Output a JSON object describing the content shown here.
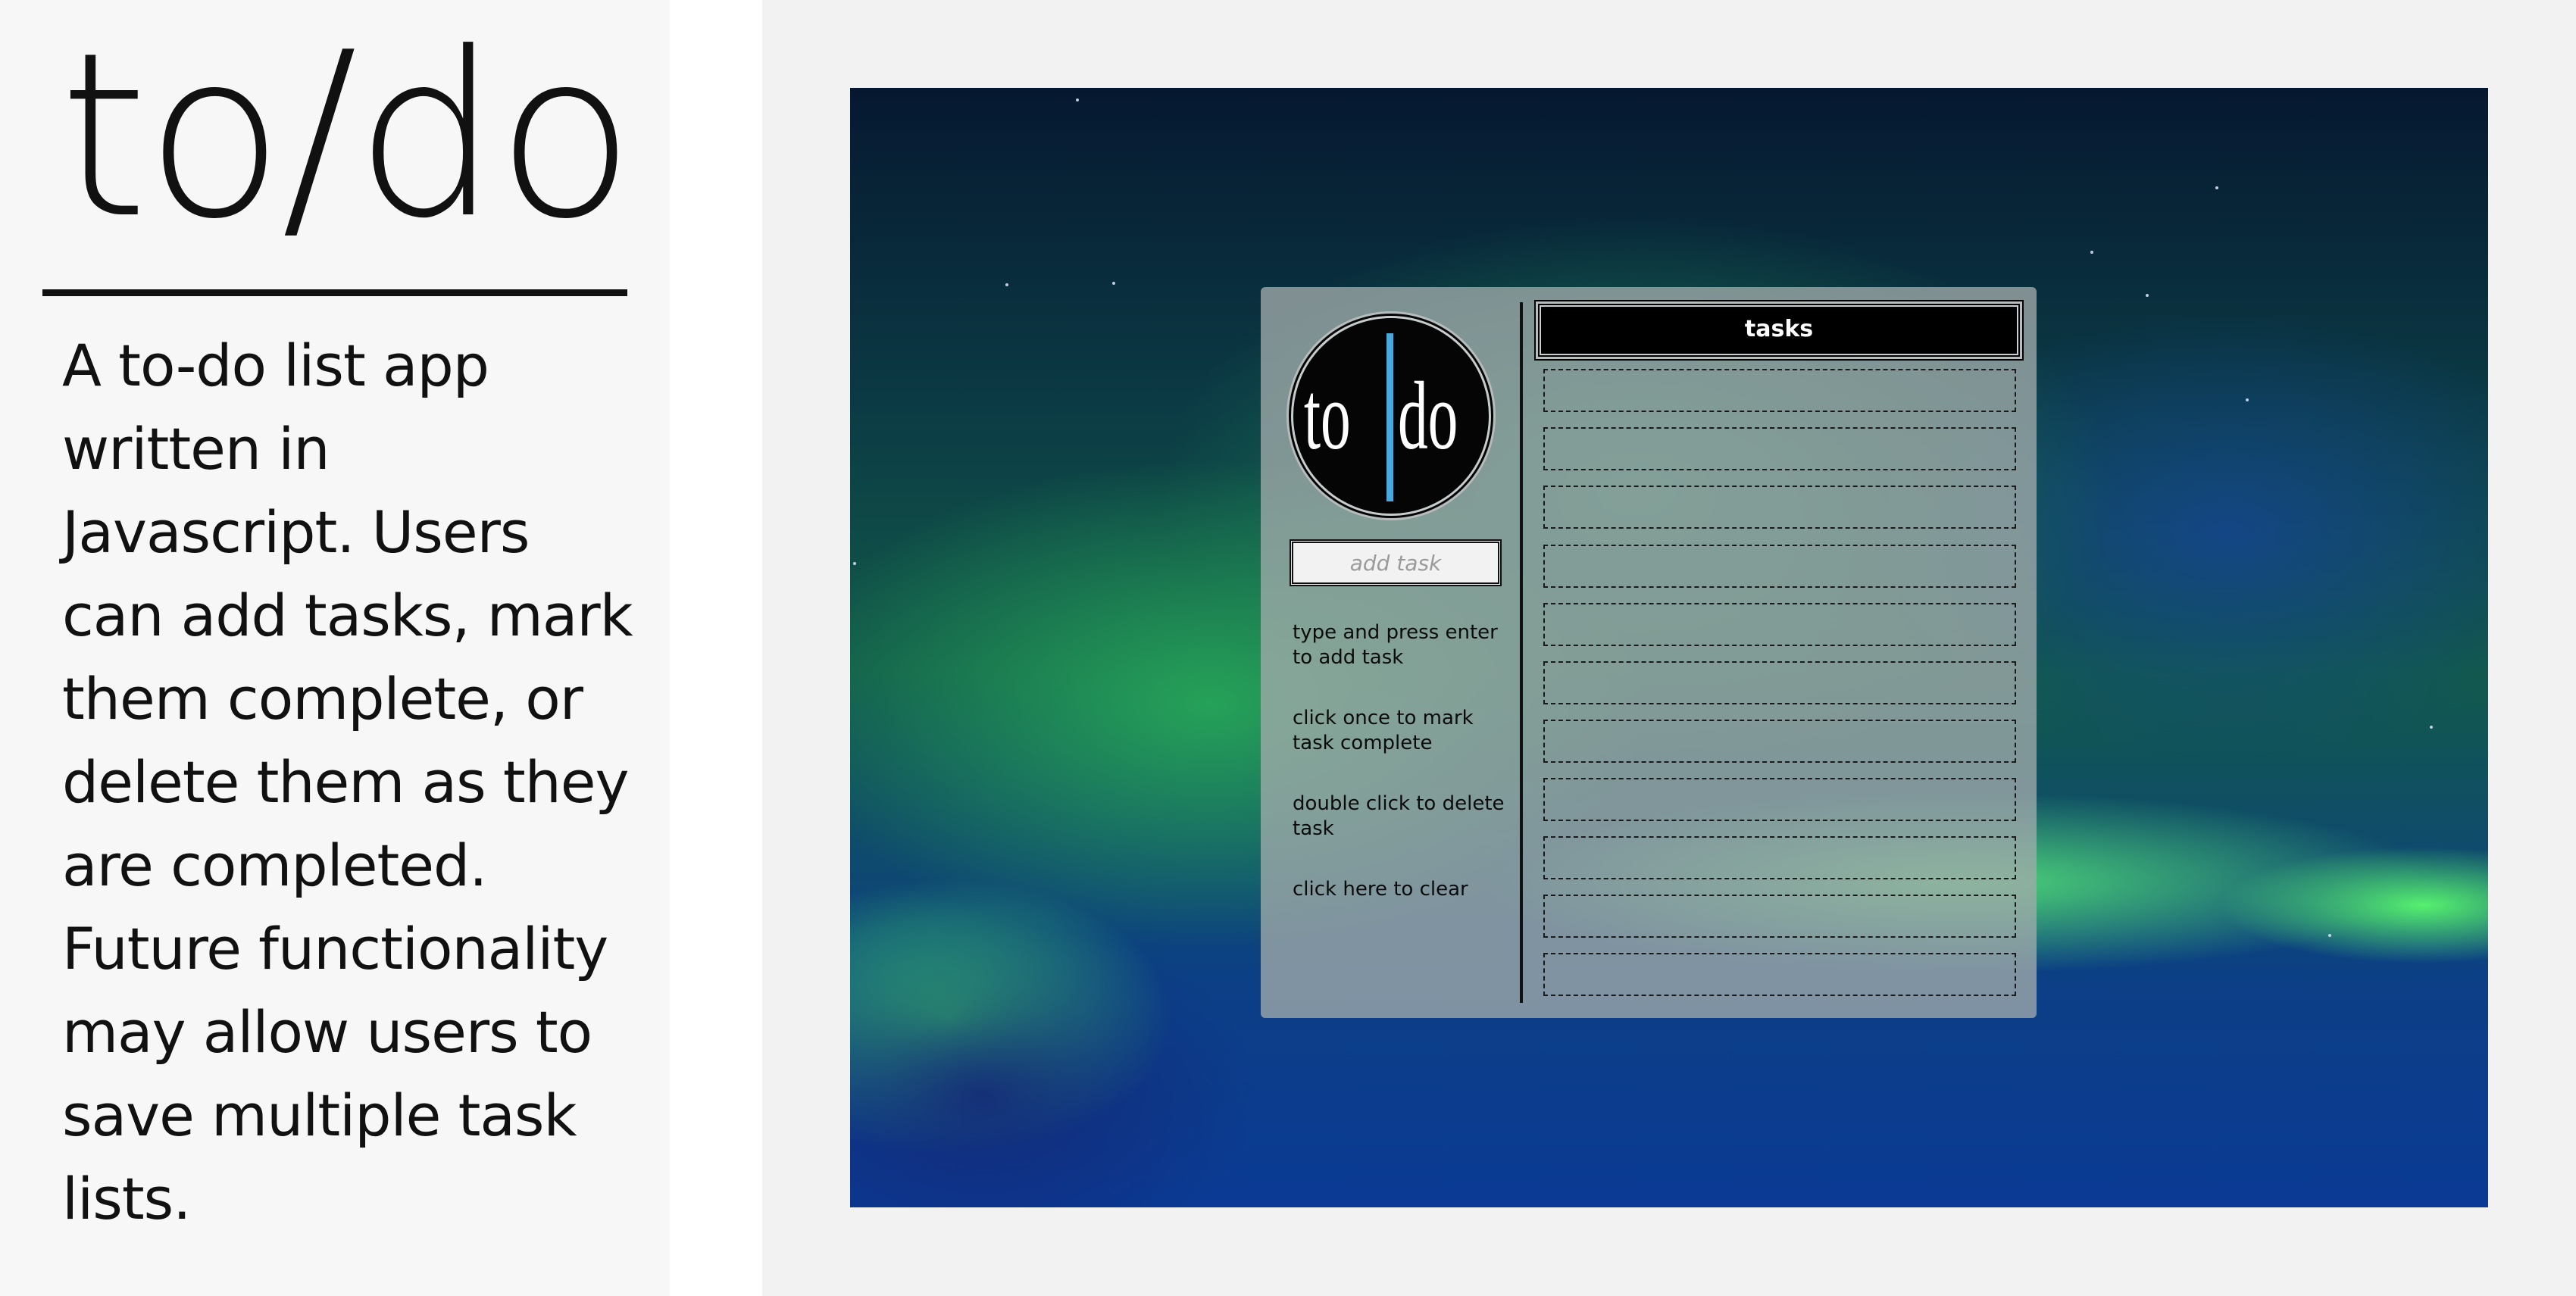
{
  "project": {
    "title": "to/do",
    "description": "A to-do list app written in Javascript. Users can add tasks, mark them complete, or delete them as they are completed. Future functionality may allow users to save multiple task lists."
  },
  "app": {
    "logo": {
      "left": "to",
      "right": "do"
    },
    "add_task_placeholder": "add task",
    "instructions": [
      "type and press enter to add task",
      "click once to mark task complete",
      "double click to delete task",
      "click here to clear"
    ],
    "tasks_header": "tasks",
    "task_slots": [
      "",
      "",
      "",
      "",
      "",
      "",
      "",
      "",
      "",
      "",
      ""
    ],
    "colors": {
      "logo_bar": "#49a9dc",
      "card": "#a0aaaa",
      "header_bg": "#000000"
    }
  }
}
